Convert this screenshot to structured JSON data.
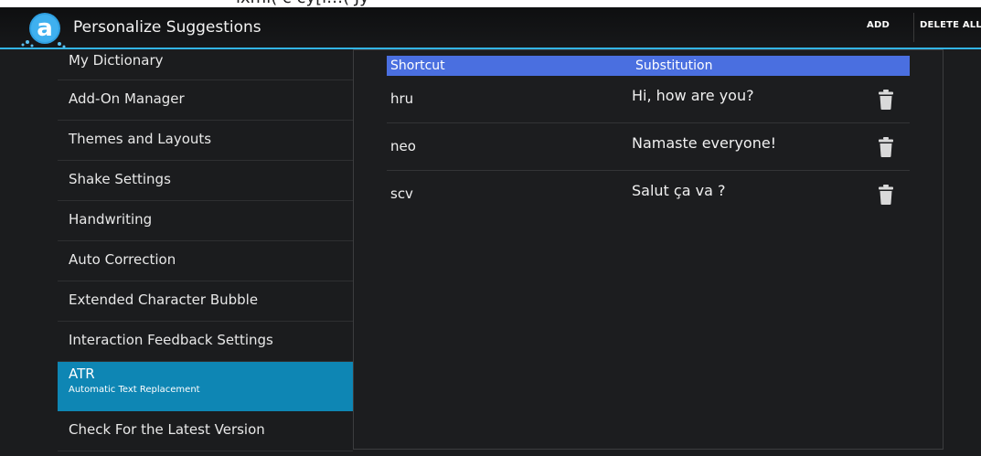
{
  "top_strip": {
    "partial_text": "ixml( c cy[l…( Jy"
  },
  "actionbar": {
    "title": "Personalize Suggestions",
    "add_label": "ADD",
    "delete_all_label": "DELETE ALL",
    "logo_icon": "app-logo-icon",
    "accent": "#33b5e5"
  },
  "menu": {
    "items": [
      {
        "label": "My Dictionary"
      },
      {
        "label": "Add-On Manager"
      },
      {
        "label": "Themes and Layouts"
      },
      {
        "label": "Shake Settings"
      },
      {
        "label": "Handwriting"
      },
      {
        "label": "Auto Correction"
      },
      {
        "label": "Extended Character Bubble"
      },
      {
        "label": "Interaction Feedback Settings"
      },
      {
        "label": "ATR",
        "sublabel": "Automatic Text Replacement",
        "selected": true
      },
      {
        "label": "Check For the Latest Version"
      }
    ],
    "selected_color": "#0e86b4"
  },
  "table": {
    "header_color": "#4a6fe0",
    "columns": [
      "Shortcut",
      "Substitution"
    ],
    "rows": [
      {
        "shortcut": "hru",
        "substitution": "Hi, how are you?",
        "icon": "trash-icon"
      },
      {
        "shortcut": "neo",
        "substitution": "Namaste everyone!",
        "icon": "trash-icon"
      },
      {
        "shortcut": "scv",
        "substitution": "Salut ça va ?",
        "icon": "trash-icon"
      }
    ]
  }
}
